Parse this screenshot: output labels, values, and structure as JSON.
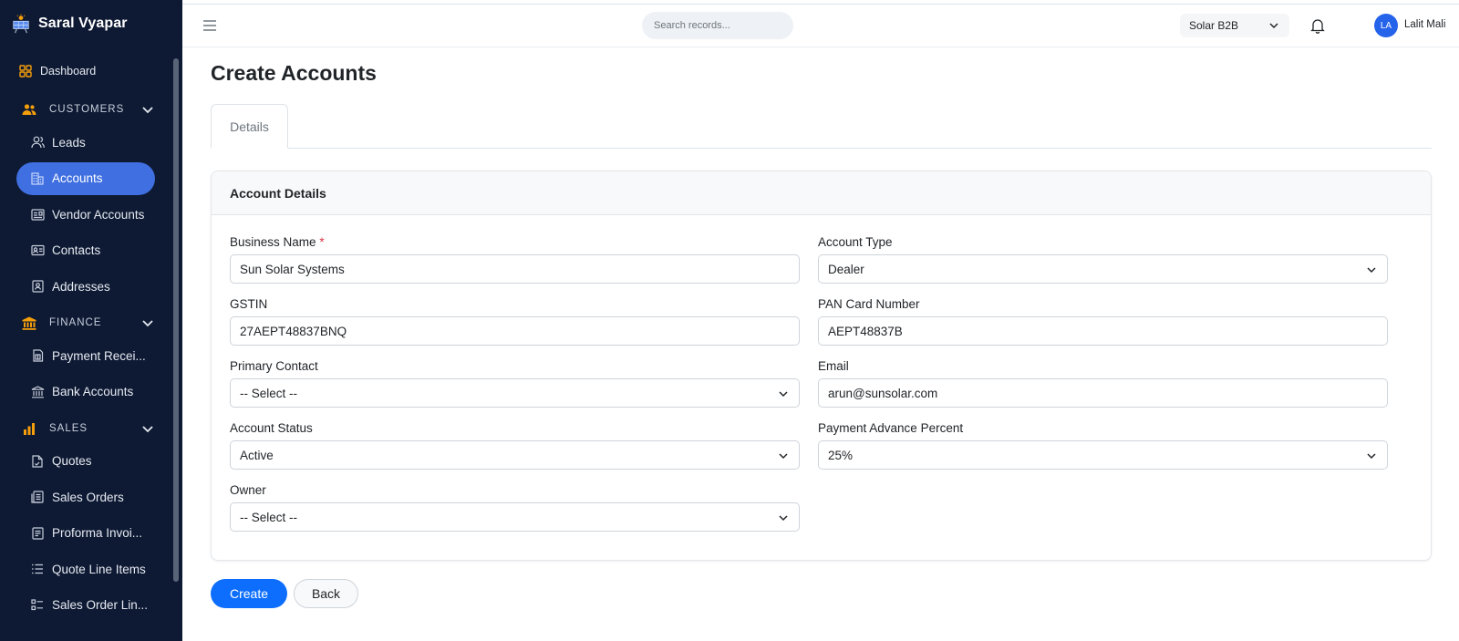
{
  "app": {
    "name": "Saral Vyapar"
  },
  "sidebar": {
    "dashboard": "Dashboard",
    "sections": {
      "customers": "CUSTOMERS",
      "finance": "FINANCE",
      "sales": "SALES"
    },
    "customers_items": [
      "Leads",
      "Accounts",
      "Vendor Accounts",
      "Contacts",
      "Addresses"
    ],
    "finance_items": [
      "Payment Recei...",
      "Bank Accounts"
    ],
    "sales_items": [
      "Quotes",
      "Sales Orders",
      "Proforma Invoi...",
      "Quote Line Items",
      "Sales Order Lin..."
    ],
    "active": "Accounts",
    "accent_color": "#3f6fe0",
    "section_icon_color": "#f59e0b"
  },
  "topbar": {
    "search_placeholder": "Search records...",
    "org": "Solar B2B",
    "avatar_initials": "LA",
    "user_name": "Lalit Mali"
  },
  "page": {
    "title": "Create Accounts",
    "tab": "Details",
    "card_title": "Account Details"
  },
  "form": {
    "business_name": {
      "label": "Business Name",
      "required": "*",
      "value": "Sun Solar Systems"
    },
    "account_type": {
      "label": "Account Type",
      "value": "Dealer"
    },
    "gstin": {
      "label": "GSTIN",
      "value": "27AEPT48837BNQ"
    },
    "pan": {
      "label": "PAN Card Number",
      "value": "AEPT48837B"
    },
    "primary_contact": {
      "label": "Primary Contact",
      "value": "-- Select --"
    },
    "email": {
      "label": "Email",
      "value": "arun@sunsolar.com"
    },
    "account_status": {
      "label": "Account Status",
      "value": "Active"
    },
    "payment_advance": {
      "label": "Payment Advance Percent",
      "value": "25%"
    },
    "owner": {
      "label": "Owner",
      "value": "-- Select --"
    }
  },
  "actions": {
    "create": "Create",
    "back": "Back"
  }
}
